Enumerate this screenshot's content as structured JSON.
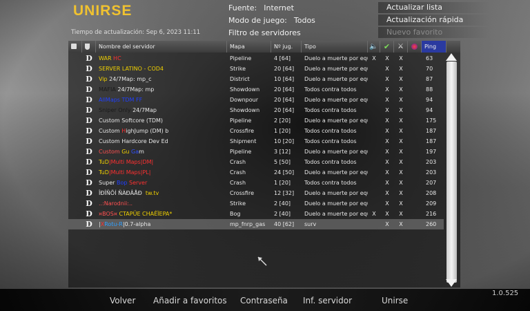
{
  "app_title": "UNIRSE",
  "refresh_label": "Tiempo de actualización: Sep 6, 2023  11:11",
  "info": {
    "source_label": "Fuente:",
    "source_value": "Internet",
    "mode_label": "Modo de juego:",
    "mode_value": "Todos",
    "filter_label": "Filtro de servidores"
  },
  "right_buttons": {
    "refresh_list": "Actualizar lista",
    "quick_refresh": "Actualización rápida",
    "new_favorite": "Nuevo favorito"
  },
  "columns": {
    "name": "Nombre del servidor",
    "map": "Mapa",
    "players": "Nº jug.",
    "type": "Tipo",
    "ping": "Ping"
  },
  "column_icons": [
    "lock-icon",
    "shield-icon",
    "speaker-icon",
    "checkmark-icon",
    "crossed-swords-icon",
    "mod-icon"
  ],
  "servers": [
    {
      "d": "D",
      "name": [
        {
          "t": "WAR ",
          "c": "#f0d000"
        },
        {
          "t": "HC",
          "c": "#ff3030"
        }
      ],
      "map": "Pipeline",
      "players": "4 [64]",
      "type": "Duelo a muerte por equ",
      "voice": "X",
      "hc": "X",
      "ffa": "X",
      "mod": "",
      "ping": "63"
    },
    {
      "d": "D",
      "name": [
        {
          "t": "SERVER LATINO - COD4",
          "c": "#f0d000"
        }
      ],
      "map": "Strike",
      "players": "20 [64]",
      "type": "Duelo a muerte por equ",
      "voice": "",
      "hc": "X",
      "ffa": "X",
      "mod": "",
      "ping": "70"
    },
    {
      "d": "D",
      "name": [
        {
          "t": "Vip ",
          "c": "#f0d000"
        },
        {
          "t": "24/7Map: mp_c",
          "c": "#e8e8e8"
        }
      ],
      "map": "District",
      "players": "10 [64]",
      "type": "Duelo a muerte por equ",
      "voice": "",
      "hc": "X",
      "ffa": "X",
      "mod": "",
      "ping": "87"
    },
    {
      "d": "D",
      "name": [
        {
          "t": "MAFIA ",
          "c": "#1a1a1a"
        },
        {
          "t": "24/7Map: mp",
          "c": "#e8e8e8"
        }
      ],
      "map": "Showdown",
      "players": "20 [64]",
      "type": "Todos contra todos",
      "voice": "",
      "hc": "X",
      "ffa": "X",
      "mod": "",
      "ping": "88"
    },
    {
      "d": "D",
      "name": [
        {
          "t": "AllMaps TDM FF",
          "c": "#2040ff"
        }
      ],
      "map": "Downpour",
      "players": "20 [64]",
      "type": "Duelo a muerte por equ",
      "voice": "",
      "hc": "X",
      "ffa": "X",
      "mod": "",
      "ping": "94"
    },
    {
      "d": "D",
      "name": [
        {
          "t": "Sniper Only ",
          "c": "#1a1a1a"
        },
        {
          "t": "24/7Map",
          "c": "#e8e8e8"
        }
      ],
      "map": "Showdown",
      "players": "20 [64]",
      "type": "Todos contra todos",
      "voice": "",
      "hc": "X",
      "ffa": "X",
      "mod": "",
      "ping": "94"
    },
    {
      "d": "D",
      "name": [
        {
          "t": "Custom Softcore (TDM)",
          "c": "#e8e8e8"
        }
      ],
      "map": "Pipeline",
      "players": "2 [20]",
      "type": "Duelo a muerte por equ",
      "voice": "",
      "hc": "X",
      "ffa": "X",
      "mod": "",
      "ping": "175"
    },
    {
      "d": "D",
      "name": [
        {
          "t": "Custom ",
          "c": "#e8e8e8"
        },
        {
          "t": "H",
          "c": "#ff3030"
        },
        {
          "t": "ighJump (DM) b",
          "c": "#e8e8e8"
        }
      ],
      "map": "Crossfire",
      "players": "1 [20]",
      "type": "Todos contra todos",
      "voice": "",
      "hc": "X",
      "ffa": "X",
      "mod": "",
      "ping": "187"
    },
    {
      "d": "D",
      "name": [
        {
          "t": "Custom Hardcore Dev Ed",
          "c": "#e8e8e8"
        }
      ],
      "map": "Shipment",
      "players": "10 [20]",
      "type": "Todos contra todos",
      "voice": "",
      "hc": "X",
      "ffa": "X",
      "mod": "",
      "ping": "187"
    },
    {
      "d": "D",
      "name": [
        {
          "t": "Custom ",
          "c": "#ff5050"
        },
        {
          "t": "Gu",
          "c": "#f0d000"
        },
        {
          "t": " ",
          "c": "#e8e8e8"
        },
        {
          "t": "Ga",
          "c": "#3050ff"
        },
        {
          "t": "m",
          "c": "#e8e8e8"
        }
      ],
      "map": "Pipeline",
      "players": "3 [12]",
      "type": "Duelo a muerte por equ",
      "voice": "",
      "hc": "X",
      "ffa": "X",
      "mod": "",
      "ping": "197"
    },
    {
      "d": "D",
      "name": [
        {
          "t": "TuD",
          "c": "#f0d000"
        },
        {
          "t": "|Multi Maps|DM|",
          "c": "#ff3030"
        }
      ],
      "map": "Crash",
      "players": "5 [50]",
      "type": "Todos contra todos",
      "voice": "",
      "hc": "X",
      "ffa": "X",
      "mod": "",
      "ping": "203"
    },
    {
      "d": "D",
      "name": [
        {
          "t": "TuD",
          "c": "#f0d000"
        },
        {
          "t": "|Multi Maps|PL|",
          "c": "#ff3030"
        }
      ],
      "map": "Crash",
      "players": "24 [50]",
      "type": "Duelo a muerte por equ",
      "voice": "",
      "hc": "X",
      "ffa": "X",
      "mod": "",
      "ping": "203"
    },
    {
      "d": "D",
      "name": [
        {
          "t": "Super ",
          "c": "#e8e8e8"
        },
        {
          "t": "Bop ",
          "c": "#2040ff"
        },
        {
          "t": "Server",
          "c": "#ff3030"
        }
      ],
      "map": "Crash",
      "players": "1 [20]",
      "type": "Todos contra todos",
      "voice": "",
      "hc": "X",
      "ffa": "X",
      "mod": "",
      "ping": "207"
    },
    {
      "d": "D",
      "name": [
        {
          "t": "ÎÐÎÑÕÍ ÑÀÐÂÅÐ  ",
          "c": "#e8e8e8"
        },
        {
          "t": "tw.tv",
          "c": "#f0d000"
        }
      ],
      "map": "Crossfire",
      "players": "12 [32]",
      "type": "Duelo a muerte por equ",
      "voice": "",
      "hc": "X",
      "ffa": "X",
      "mod": "",
      "ping": "208"
    },
    {
      "d": "D",
      "name": [
        {
          "t": "..:Narodnii:..",
          "c": "#ff5050"
        }
      ],
      "map": "Strike",
      "players": "2 [40]",
      "type": "Duelo a muerte por equ",
      "voice": "",
      "hc": "X",
      "ffa": "X",
      "mod": "",
      "ping": "209"
    },
    {
      "d": "D",
      "name": [
        {
          "t": "¤BOS¤ ",
          "c": "#ff5050"
        },
        {
          "t": "CTAPÜE CHAÊÏEPA*",
          "c": "#f0d000"
        }
      ],
      "map": "Bog",
      "players": "2 [40]",
      "type": "Duelo a muerte por equ",
      "voice": "X",
      "hc": "X",
      "ffa": "X",
      "mod": "",
      "ping": "216"
    },
    {
      "d": "D",
      "name": [
        {
          "t": "|",
          "c": "#e8e8e8"
        },
        {
          "t": "X",
          "c": "#ff3030"
        },
        {
          "t": "Rotu-R",
          "c": "#30a0ff"
        },
        {
          "t": "|0.7-alpha",
          "c": "#e8e8e8"
        }
      ],
      "map": "mp_fnrp_gas",
      "players": "40 [62]",
      "type": "surv",
      "voice": "",
      "hc": "X",
      "ffa": "X",
      "mod": "",
      "ping": "260",
      "selected": true
    }
  ],
  "bottom_buttons": {
    "back": "Volver",
    "add_fav": "Añadir a favoritos",
    "password": "Contraseña",
    "server_info": "Inf. servidor",
    "join": "Unirse"
  },
  "version": "1.0.525"
}
